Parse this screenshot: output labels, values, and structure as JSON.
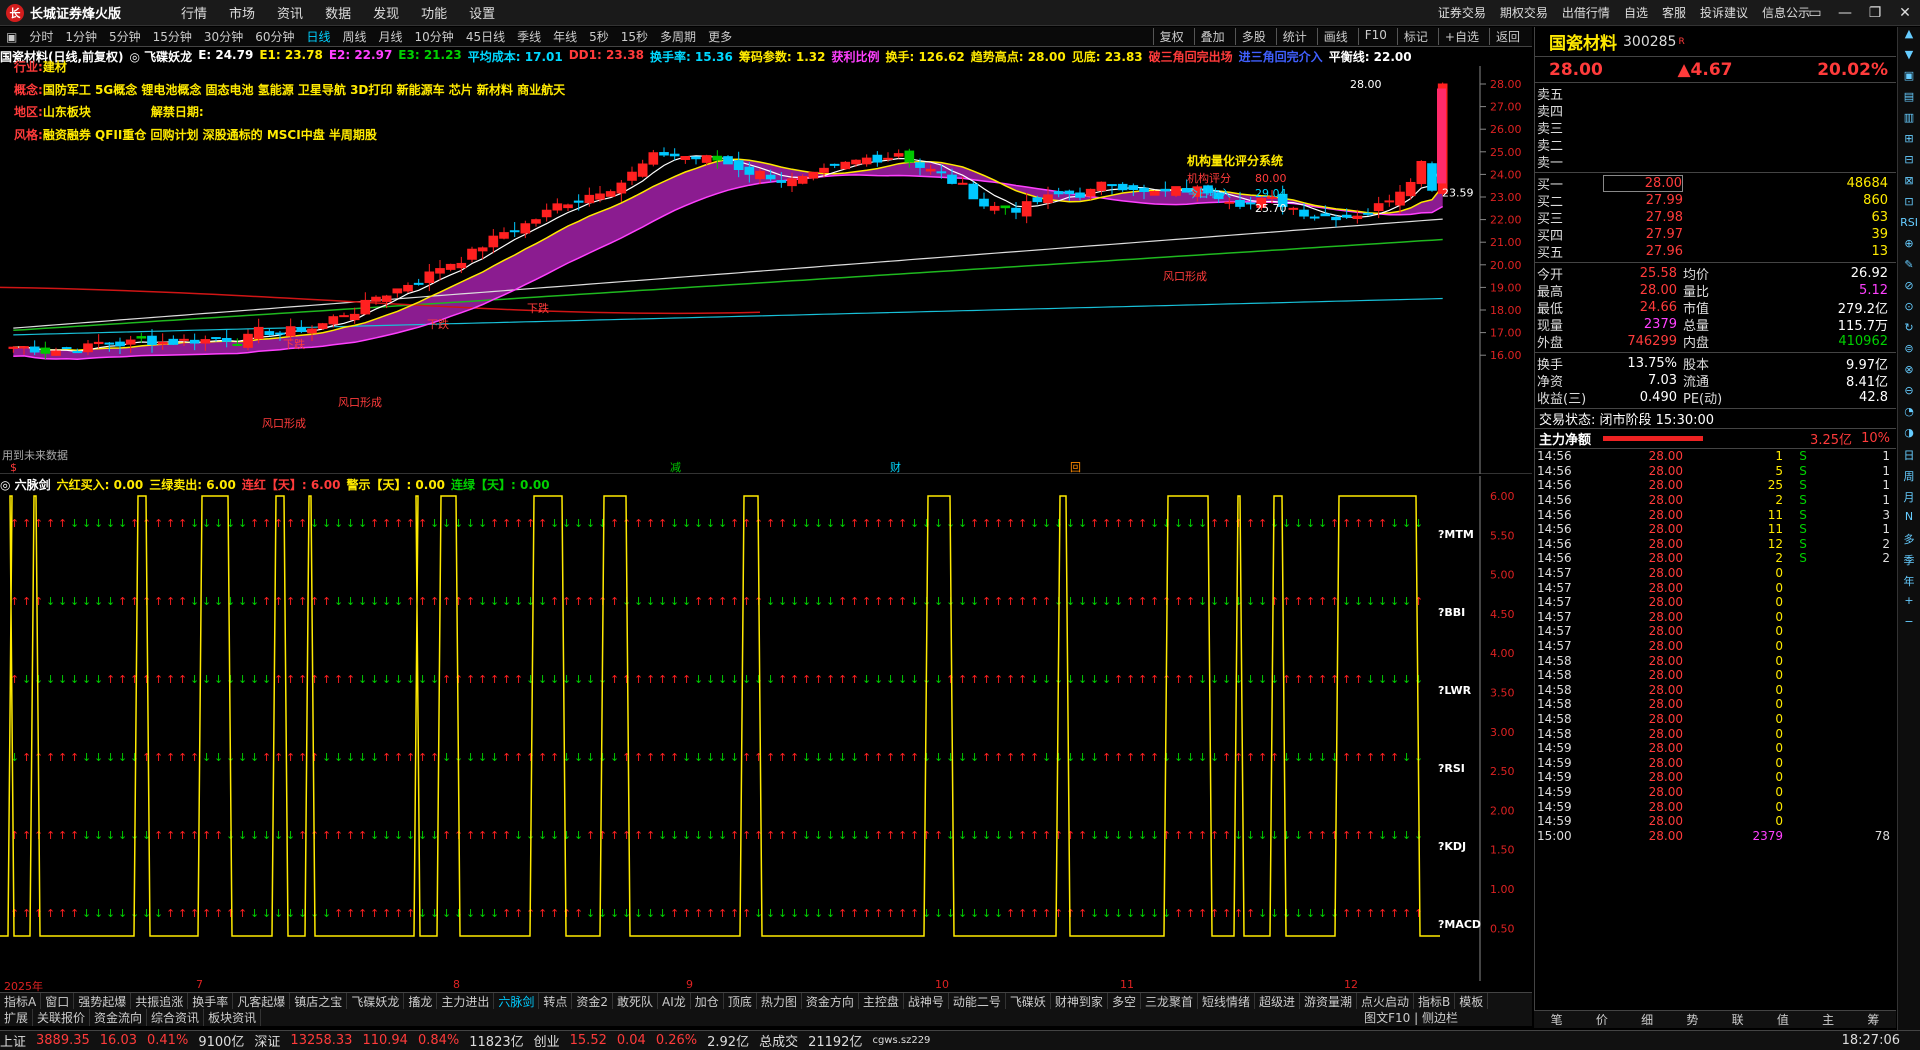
{
  "window": {
    "title": "长城证券烽火版",
    "logo": "长",
    "menu": [
      "行情",
      "市场",
      "资讯",
      "数据",
      "发现",
      "功能",
      "设置"
    ],
    "right_menu": [
      "证券交易",
      "期权交易",
      "出借行情",
      "自选",
      "客服",
      "投诉建议",
      "信息公示"
    ],
    "controls": [
      "▭",
      "—",
      "❐",
      "✕"
    ]
  },
  "periods": {
    "items": [
      "分时",
      "1分钟",
      "5分钟",
      "15分钟",
      "30分钟",
      "60分钟",
      "日线",
      "周线",
      "月线",
      "10分钟",
      "45日线",
      "季线",
      "年线",
      "5秒",
      "15秒",
      "多周期",
      "更多"
    ],
    "active": "日线",
    "right": [
      "复权",
      "叠加",
      "多股",
      "统计",
      "画线",
      "F10",
      "标记",
      "+自选",
      "返回"
    ]
  },
  "info_line": [
    {
      "t": "国瓷材料(日线,前复权)",
      "c": "#ffffff"
    },
    {
      "t": "◎ 飞碟妖龙",
      "c": "#ffffff"
    },
    {
      "t": "E: 24.79",
      "c": "#ffffff"
    },
    {
      "t": "E1: 23.78",
      "c": "#ffea00"
    },
    {
      "t": "E2: 22.97",
      "c": "#ff40ff"
    },
    {
      "t": "E3: 21.23",
      "c": "#00d000"
    },
    {
      "t": "平均成本: 17.01",
      "c": "#00d8ff"
    },
    {
      "t": "DD1: 23.38",
      "c": "#ff3b3b"
    },
    {
      "t": "换手率: 15.36",
      "c": "#00d8ff"
    },
    {
      "t": "筹码参数: 1.32",
      "c": "#ffea00"
    },
    {
      "t": "获利比例",
      "c": "#ff40ff"
    },
    {
      "t": "换手: 126.62",
      "c": "#ffea00"
    },
    {
      "t": "趋势高点: 28.00",
      "c": "#ffea00"
    },
    {
      "t": "见底: 23.83",
      "c": "#ffea00"
    },
    {
      "t": "破三角回完出场",
      "c": "#ff3b3b"
    },
    {
      "t": "进三角回完介入",
      "c": "#4060ff"
    },
    {
      "t": "平衡线: 22.00",
      "c": "#ffffff"
    }
  ],
  "stock_info": {
    "industry_label": "行业:",
    "industry": "建材",
    "concept_label": "概念:",
    "concepts": "国防军工 5G概念 锂电池概念 固态电池 氢能源 卫星导航 3D打印 新能源车 芯片 新材料 商业航天",
    "region_label": "地区:",
    "region": "山东板块",
    "unlock_label": "解禁日期:",
    "style_label": "风格:",
    "style": "融资融券 QFII重仓 回购计划 深股通标的 MSCI中盘 半周期股"
  },
  "chart_annotations": {
    "future_data": "用到未来数据",
    "eval_title": "机构量化评分系统",
    "inst_label": "机构评分",
    "inst_value": "80.00",
    "today_label": "今日收入",
    "today_value": "29.04",
    "value3": "25.70",
    "high_label": "28.00",
    "price_label": "23.59",
    "feng1": "风口形成",
    "feng2": "风口形成",
    "feng3": "风口形成",
    "xiadie1": "下跌",
    "xiadie2": "下跌",
    "xiadie3": "下跌",
    "markers": [
      "$",
      "减",
      "财",
      "回"
    ]
  },
  "price_axis": [
    "28.00",
    "27.00",
    "26.00",
    "25.00",
    "24.00",
    "23.00",
    "22.00",
    "21.00",
    "20.00",
    "19.00",
    "18.00",
    "17.00",
    "16.00"
  ],
  "indicator": {
    "name": "六脉剑",
    "head": [
      {
        "t": "◎ 六脉剑",
        "c": "#ffffff"
      },
      {
        "t": "六红买入: 0.00",
        "c": "#ffea00"
      },
      {
        "t": "三绿卖出: 6.00",
        "c": "#ffea00"
      },
      {
        "t": "连红【天】: 6.00",
        "c": "#ff3b3b"
      },
      {
        "t": "警示【天】: 0.00",
        "c": "#ffea00"
      },
      {
        "t": "连绿【天】: 0.00",
        "c": "#00d000"
      }
    ],
    "rows": [
      "?MTM",
      "?BBI",
      "?LWR",
      "?RSI",
      "?KDJ",
      "?MACD"
    ],
    "axis": [
      "6.00",
      "5.50",
      "5.00",
      "4.50",
      "4.00",
      "3.50",
      "3.00",
      "2.50",
      "2.00",
      "1.50",
      "1.00",
      "0.50"
    ]
  },
  "date_axis": [
    "2025年",
    "7",
    "8",
    "9",
    "10",
    "11",
    "12"
  ],
  "tabs1": [
    "指标A",
    "窗口",
    "强势起爆",
    "共振追涨",
    "换手率",
    "凡客起爆",
    "镇店之宝",
    "飞碟妖龙",
    "搐龙",
    "主力进出",
    "六脉剑",
    "转点",
    "资金2",
    "敢死队",
    "AI龙",
    "加仓",
    "顶底",
    "热力图",
    "资金方向",
    "主控盘",
    "战神号",
    "动能二号",
    "飞碟妖",
    "财神到家",
    "多空",
    "三龙聚首",
    "短线情绪",
    "超级进",
    "游资量潮",
    "点火启动",
    "指标B",
    "模板"
  ],
  "tabs1_active": "六脉剑",
  "tabs2": [
    "扩展",
    "关联报价",
    "资金流向",
    "综合资讯",
    "板块资讯"
  ],
  "tabs2_right": "图文F10 | 侧边栏",
  "status": {
    "sh_label": "上证",
    "sh": "3889.35",
    "sh_chg": "16.03",
    "sh_pct": "0.41%",
    "sh_amt": "9100亿",
    "sz_label": "深证",
    "sz": "13258.33",
    "sz_chg": "110.94",
    "sz_pct": "0.84%",
    "sz_amt": "11823亿",
    "cy_label": "创业",
    "cy": "15.52",
    "cy_chg": "0.04",
    "cy_pct": "0.26%",
    "cy_amt": "2.92亿",
    "total_label": "总成交",
    "total": "21192亿",
    "server": "cgws.sz229",
    "time": "18:27:06"
  },
  "quote": {
    "name": "国瓷材料",
    "code": "300285",
    "flag": "R",
    "price": "28.00",
    "change": "▲4.67",
    "pct": "20.02%",
    "asks": [
      [
        "卖五",
        "",
        ""
      ],
      [
        "卖四",
        "",
        ""
      ],
      [
        "卖三",
        "",
        ""
      ],
      [
        "卖二",
        "",
        ""
      ],
      [
        "卖一",
        "",
        ""
      ]
    ],
    "bids": [
      [
        "买一",
        "28.00",
        "48684"
      ],
      [
        "买二",
        "27.99",
        "860"
      ],
      [
        "买三",
        "27.98",
        "63"
      ],
      [
        "买四",
        "27.97",
        "39"
      ],
      [
        "买五",
        "27.96",
        "13"
      ]
    ],
    "stats": [
      [
        "今开",
        "25.58",
        "均价",
        "26.92"
      ],
      [
        "最高",
        "28.00",
        "量比",
        "5.12"
      ],
      [
        "最低",
        "24.66",
        "市值",
        "279.2亿"
      ],
      [
        "现量",
        "2379",
        "总量",
        "115.7万"
      ],
      [
        "外盘",
        "746299",
        "内盘",
        "410962"
      ]
    ],
    "stats2": [
      [
        "换手",
        "13.75%",
        "股本",
        "9.97亿"
      ],
      [
        "净资",
        "7.03",
        "流通",
        "8.41亿"
      ],
      [
        "收益(三)",
        "0.490",
        "PE(动)",
        "42.8"
      ]
    ],
    "trade_state": "交易状态: 闭市阶段 15:30:00",
    "main_flow_label": "主力净额",
    "main_flow": "3.25亿",
    "main_flow_pct": "10%",
    "ticks": [
      [
        "14:56",
        "28.00",
        "1",
        "S",
        "1"
      ],
      [
        "14:56",
        "28.00",
        "5",
        "S",
        "1"
      ],
      [
        "14:56",
        "28.00",
        "25",
        "S",
        "1"
      ],
      [
        "14:56",
        "28.00",
        "2",
        "S",
        "1"
      ],
      [
        "14:56",
        "28.00",
        "11",
        "S",
        "3"
      ],
      [
        "14:56",
        "28.00",
        "11",
        "S",
        "1"
      ],
      [
        "14:56",
        "28.00",
        "12",
        "S",
        "2"
      ],
      [
        "14:56",
        "28.00",
        "2",
        "S",
        "2"
      ],
      [
        "14:57",
        "28.00",
        "0",
        "",
        ""
      ],
      [
        "14:57",
        "28.00",
        "0",
        "",
        ""
      ],
      [
        "14:57",
        "28.00",
        "0",
        "",
        ""
      ],
      [
        "14:57",
        "28.00",
        "0",
        "",
        ""
      ],
      [
        "14:57",
        "28.00",
        "0",
        "",
        ""
      ],
      [
        "14:57",
        "28.00",
        "0",
        "",
        ""
      ],
      [
        "14:58",
        "28.00",
        "0",
        "",
        ""
      ],
      [
        "14:58",
        "28.00",
        "0",
        "",
        ""
      ],
      [
        "14:58",
        "28.00",
        "0",
        "",
        ""
      ],
      [
        "14:58",
        "28.00",
        "0",
        "",
        ""
      ],
      [
        "14:58",
        "28.00",
        "0",
        "",
        ""
      ],
      [
        "14:58",
        "28.00",
        "0",
        "",
        ""
      ],
      [
        "14:59",
        "28.00",
        "0",
        "",
        ""
      ],
      [
        "14:59",
        "28.00",
        "0",
        "",
        ""
      ],
      [
        "14:59",
        "28.00",
        "0",
        "",
        ""
      ],
      [
        "14:59",
        "28.00",
        "0",
        "",
        ""
      ],
      [
        "14:59",
        "28.00",
        "0",
        "",
        ""
      ],
      [
        "14:59",
        "28.00",
        "0",
        "",
        ""
      ],
      [
        "15:00",
        "28.00",
        "2379",
        "",
        "78"
      ]
    ],
    "bottom_tabs": [
      "笔",
      "价",
      "细",
      "势",
      "联",
      "值",
      "主",
      "筹"
    ]
  },
  "side_icons": [
    "▲",
    "▼",
    "▣",
    "▤",
    "▥",
    "⊞",
    "⊟",
    "⊠",
    "⊡",
    "RSI",
    "⊕",
    "✎",
    "⊘",
    "⊙",
    "↻",
    "⊜",
    "⊗",
    "⊖",
    "◔",
    "◑",
    "日",
    "周",
    "月",
    "N",
    "多",
    "季",
    "年",
    "+",
    "−"
  ]
}
